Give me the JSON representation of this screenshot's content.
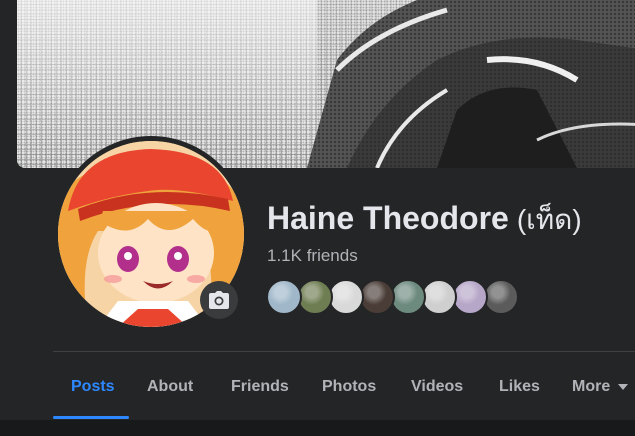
{
  "profile": {
    "name": "Haine Theodore",
    "alternate_name": "(เท็ด)",
    "friends_count": "1.1K friends"
  },
  "avatar": {
    "icon": "camera-icon"
  },
  "friend_faces": [
    {
      "name": "friend-1",
      "color": "#9fb7c9"
    },
    {
      "name": "friend-2",
      "color": "#6f7d52"
    },
    {
      "name": "friend-3",
      "color": "#d9d9d9"
    },
    {
      "name": "friend-4",
      "color": "#4a3d37"
    },
    {
      "name": "friend-5",
      "color": "#6d8a7f"
    },
    {
      "name": "friend-6",
      "color": "#cfcfcf"
    },
    {
      "name": "friend-7",
      "color": "#b6a6c8"
    },
    {
      "name": "friend-8",
      "color": "#5b5b5b"
    }
  ],
  "tabs": [
    {
      "label": "Posts",
      "active": true
    },
    {
      "label": "About"
    },
    {
      "label": "Friends"
    },
    {
      "label": "Photos"
    },
    {
      "label": "Videos"
    },
    {
      "label": "Likes"
    },
    {
      "label": "More"
    }
  ],
  "colors": {
    "accent": "#2d88ff",
    "background": "#242526",
    "text_primary": "#e4e6eb",
    "text_secondary": "#b0b3b8"
  }
}
